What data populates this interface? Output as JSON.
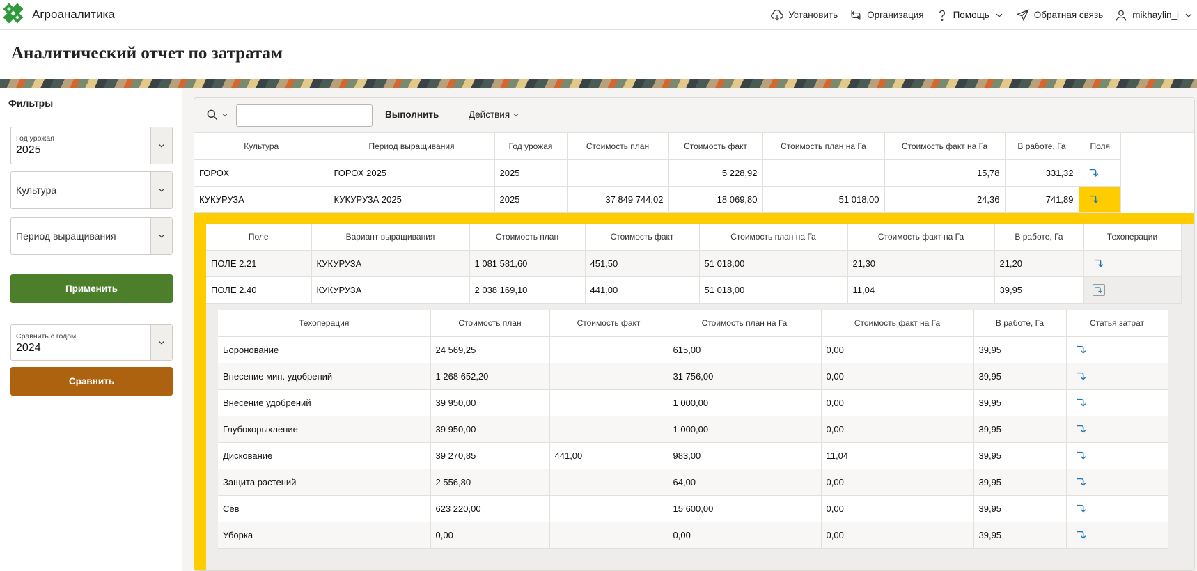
{
  "app": {
    "name": "Агроаналитика",
    "nav": [
      {
        "label": "Установить",
        "icon": "cloud-download-icon"
      },
      {
        "label": "Организация",
        "icon": "switch-icon"
      },
      {
        "label": "Помощь",
        "icon": "question-icon"
      },
      {
        "label": "Обратная связь",
        "icon": "send-icon"
      },
      {
        "label": "mikhaylin_i",
        "icon": "user-icon"
      }
    ]
  },
  "page": {
    "title": "Аналитический отчет по затратам"
  },
  "filters": {
    "title": "Фильтры",
    "year": {
      "label": "Год урожая",
      "value": "2025"
    },
    "culture": {
      "label": "Культура",
      "value": ""
    },
    "period": {
      "label": "Период выращивания",
      "value": ""
    },
    "apply_label": "Применить",
    "compare_year": {
      "label": "Сравнить с годом",
      "value": "2024"
    },
    "compare_label": "Сравнить"
  },
  "toolbar": {
    "search_value": "",
    "run_label": "Выполнить",
    "actions_label": "Действия"
  },
  "master": {
    "columns": [
      "Культура",
      "Период выращивания",
      "Год урожая",
      "Стоимость план",
      "Стоимость факт",
      "Стоимость план на Га",
      "Стоимость факт на Га",
      "В работе, Га",
      "Поля"
    ],
    "rows": [
      [
        "ГОРОХ",
        "ГОРОХ 2025",
        "2025",
        "",
        "5 228,92",
        "",
        "15,78",
        "331,32"
      ],
      [
        "КУКУРУЗА",
        "КУКУРУЗА 2025",
        "2025",
        "37 849 744,02",
        "18 069,80",
        "51 018,00",
        "24,36",
        "741,89"
      ]
    ]
  },
  "fields": {
    "columns": [
      "Поле",
      "Вариант выращивания",
      "Стоимость план",
      "Стоимость факт",
      "Стоимость план на Га",
      "Стоимость факт на Га",
      "В работе, Га",
      "Техоперации"
    ],
    "rows": [
      [
        "ПОЛЕ 2.21",
        "КУКУРУЗА",
        "1 081 581,60",
        "451,50",
        "51 018,00",
        "21,30",
        "21,20"
      ],
      [
        "ПОЛЕ 2.40",
        "КУКУРУЗА",
        "2 038 169,10",
        "441,00",
        "51 018,00",
        "11,04",
        "39,95"
      ]
    ]
  },
  "operations": {
    "columns": [
      "Техоперация",
      "Стоимость план",
      "Стоимость факт",
      "Стоимость план на Га",
      "Стоимость факт на Га",
      "В работе, Га",
      "Статья затрат"
    ],
    "rows": [
      [
        "Боронование",
        "24 569,25",
        "",
        "615,00",
        "0,00",
        "39,95"
      ],
      [
        "Внесение мин. удобрений",
        "1 268 652,20",
        "",
        "31 756,00",
        "0,00",
        "39,95"
      ],
      [
        "Внесение удобрений",
        "39 950,00",
        "",
        "1 000,00",
        "0,00",
        "39,95"
      ],
      [
        "Глубокорыхление",
        "39 950,00",
        "",
        "1 000,00",
        "0,00",
        "39,95"
      ],
      [
        "Дискование",
        "39 270,85",
        "441,00",
        "983,00",
        "11,04",
        "39,95"
      ],
      [
        "Защита растений",
        "2 556,80",
        "",
        "64,00",
        "0,00",
        "39,95"
      ],
      [
        "Сев",
        "623 220,00",
        "",
        "15 600,00",
        "0,00",
        "39,95"
      ],
      [
        "Уборка",
        "0,00",
        "",
        "0,00",
        "0,00",
        "39,95"
      ]
    ]
  },
  "colors": {
    "highlight": "#ffcc00",
    "apply": "#4b7f2a",
    "compare": "#ad6210",
    "drill_icon": "#1f7ab8"
  }
}
